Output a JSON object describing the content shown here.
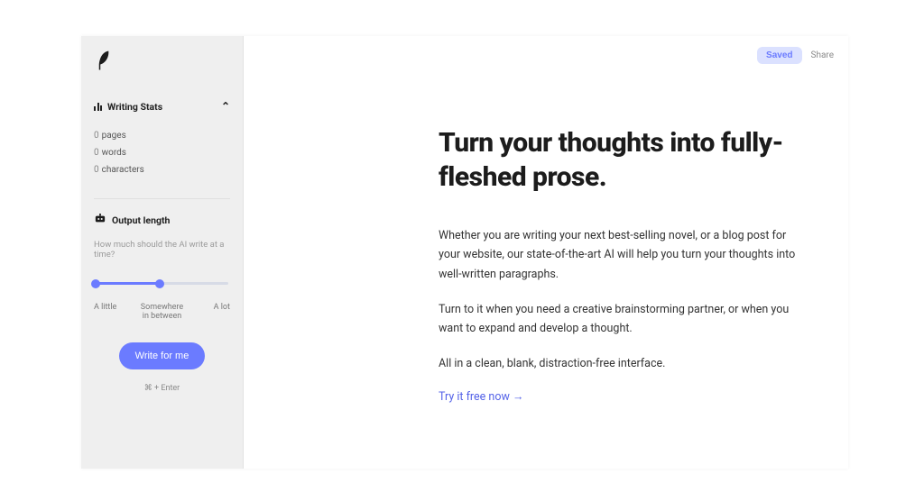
{
  "sidebar": {
    "stats_header": "Writing Stats",
    "stats": [
      {
        "count": "0",
        "label": "pages"
      },
      {
        "count": "0",
        "label": "words"
      },
      {
        "count": "0",
        "label": "characters"
      }
    ],
    "output_header": "Output length",
    "output_hint": "How much should the AI write at a time?",
    "slider_labels": {
      "min": "A little",
      "mid": "Somewhere in between",
      "max": "A lot"
    },
    "write_button": "Write for me",
    "shortcut": "⌘ + Enter"
  },
  "topbar": {
    "saved": "Saved",
    "share": "Share"
  },
  "document": {
    "title": "Turn your thoughts into fully-fleshed prose.",
    "p1": "Whether you are writing your next best-selling novel, or a blog post for your website, our state-of-the-art AI will help you turn your thoughts into well-written paragraphs.",
    "p2": "Turn to it when you need a creative brainstorming partner, or when you want to expand and develop a thought.",
    "p3": "All in a clean, blank, distraction-free interface.",
    "cta": "Try it free now →"
  },
  "colors": {
    "accent": "#6b7bff"
  }
}
